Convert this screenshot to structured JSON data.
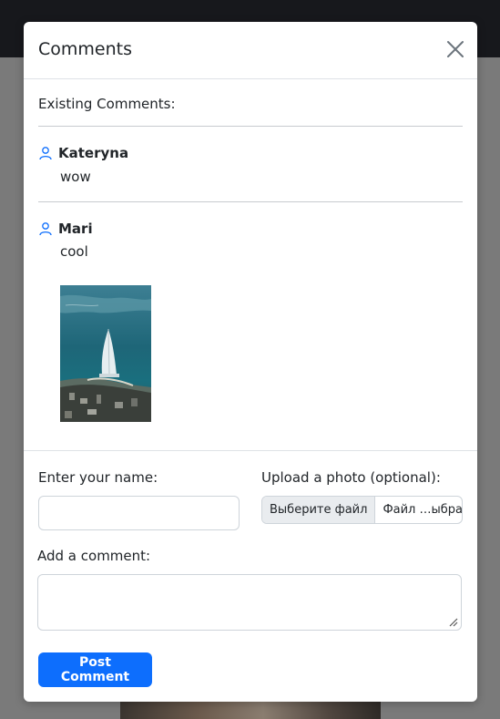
{
  "modal": {
    "title": "Comments",
    "close_icon": "close-icon"
  },
  "existing": {
    "label": "Existing Comments:",
    "comments": [
      {
        "author": "Kateryna",
        "text": "wow",
        "icon": "user-icon"
      },
      {
        "author": "Mari",
        "text": "cool",
        "icon": "user-icon",
        "photo": "burj-al-arab-aerial-photo"
      }
    ]
  },
  "form": {
    "name_label": "Enter your name:",
    "name_value": "",
    "upload_label": "Upload a photo (optional):",
    "file_button": "Выберите файл",
    "file_status": "Файл …ыбран",
    "comment_label": "Add a comment:",
    "comment_value": "",
    "submit_label": "Post Comment"
  },
  "colors": {
    "accent": "#0d6efd",
    "user_icon": "#0d6efd",
    "backdrop": "#7a7a7a",
    "topbar": "#17181c"
  }
}
